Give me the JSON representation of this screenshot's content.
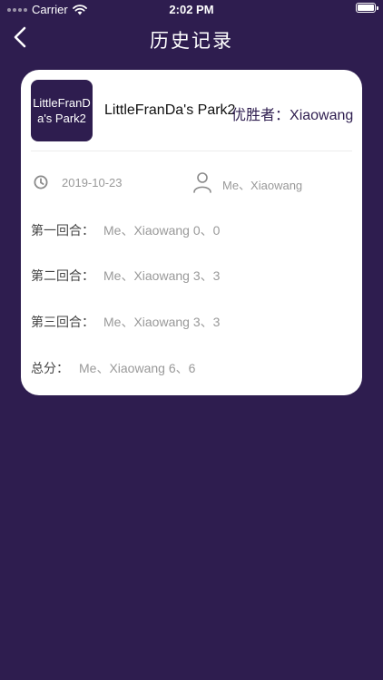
{
  "status_bar": {
    "carrier": "Carrier",
    "time": "2:02 PM",
    "wifi_icon": "wifi-icon",
    "battery_icon": "battery-icon"
  },
  "nav": {
    "title": "历史记录",
    "back_icon": "chevron-left-icon"
  },
  "record": {
    "thumbnail_text": "LittleFranDa's Park2",
    "park_name": "LittleFranDa's Park2",
    "winner_label": "优胜者：",
    "winner_name": "Xiaowang",
    "date": "2019-10-23",
    "players": "Me、Xiaowang",
    "rounds": [
      {
        "label": "第一回合：",
        "value": "Me、Xiaowang 0、0"
      },
      {
        "label": "第二回合：",
        "value": "Me、Xiaowang 3、3"
      },
      {
        "label": "第三回合：",
        "value": "Me、Xiaowang 3、3"
      }
    ],
    "total": {
      "label": "总分：",
      "value": "Me、Xiaowang 6、6"
    }
  },
  "colors": {
    "background": "#2e1d4f",
    "card": "#ffffff",
    "accent": "#2e1d4f",
    "muted_text": "#999999"
  }
}
